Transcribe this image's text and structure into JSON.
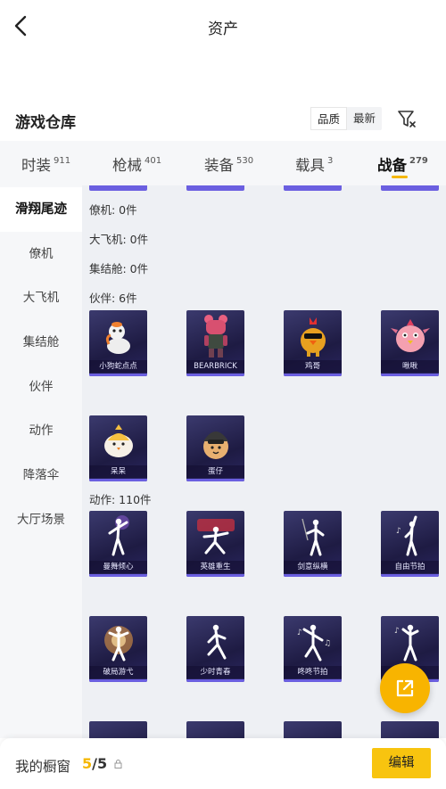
{
  "header": {
    "title": "资产"
  },
  "section": {
    "title": "游戏仓库"
  },
  "sort": {
    "quality_label": "品质",
    "latest_label": "最新"
  },
  "tabs": [
    {
      "label": "时装",
      "count": "911"
    },
    {
      "label": "枪械",
      "count": "401"
    },
    {
      "label": "装备",
      "count": "530"
    },
    {
      "label": "载具",
      "count": "3"
    },
    {
      "label": "战备",
      "count": "279"
    }
  ],
  "sidebar": {
    "items": [
      {
        "label": "滑翔尾迹"
      },
      {
        "label": "僚机"
      },
      {
        "label": "大飞机"
      },
      {
        "label": "集结舱"
      },
      {
        "label": "伙伴"
      },
      {
        "label": "动作"
      },
      {
        "label": "降落伞"
      },
      {
        "label": "大厅场景"
      }
    ]
  },
  "groups": {
    "wingman": "僚机: 0件",
    "plane": "大飞机: 0件",
    "pod": "集结舱: 0件",
    "partner": "伙伴: 6件",
    "emote": "动作: 110件"
  },
  "partners": [
    {
      "name": "小狗蛇点点"
    },
    {
      "name": "BEARBRICK"
    },
    {
      "name": "鸡哥"
    },
    {
      "name": "啾啾"
    },
    {
      "name": "呆呆"
    },
    {
      "name": "蛋仔"
    }
  ],
  "emotes": [
    {
      "name": "曼舞倾心"
    },
    {
      "name": "英雄重生"
    },
    {
      "name": "剑意纵横"
    },
    {
      "name": "自由节拍"
    },
    {
      "name": "破局游弋"
    },
    {
      "name": "少时青春"
    },
    {
      "name": "咚咚节拍"
    },
    {
      "name": ""
    }
  ],
  "bottom": {
    "label": "我的橱窗",
    "current": "5",
    "total": "/5",
    "edit_label": "编辑"
  },
  "colors": {
    "accent": "#f8c40f",
    "card_bg": "#2a2660",
    "card_bar": "#6b5fe0"
  }
}
